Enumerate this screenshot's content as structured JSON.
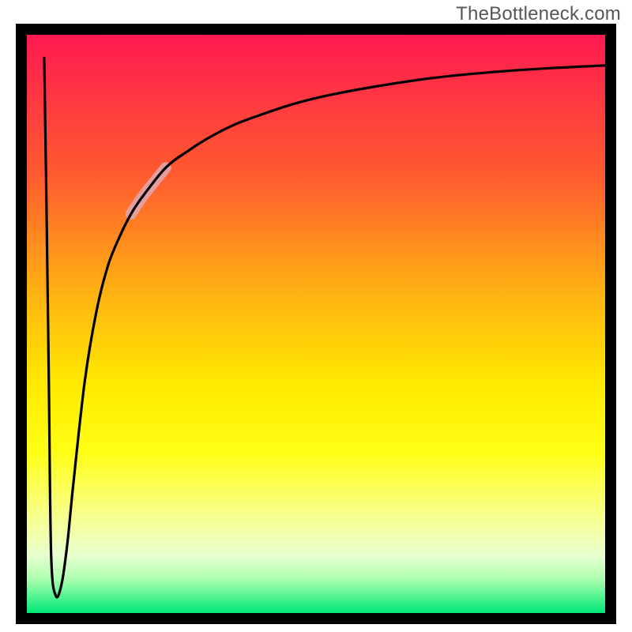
{
  "watermark_text": "TheBottleneck.com",
  "chart_data": {
    "type": "line",
    "title": "",
    "xlabel": "",
    "ylabel": "",
    "xlim": [
      0,
      100
    ],
    "ylim": [
      0,
      100
    ],
    "grid": false,
    "legend": "none",
    "background_gradient": {
      "stops": [
        {
          "offset": 0.0,
          "color": "#ff1a51"
        },
        {
          "offset": 0.25,
          "color": "#ff5d2e"
        },
        {
          "offset": 0.45,
          "color": "#ffb412"
        },
        {
          "offset": 0.6,
          "color": "#ffe800"
        },
        {
          "offset": 0.72,
          "color": "#ffff14"
        },
        {
          "offset": 0.84,
          "color": "#f6ff96"
        },
        {
          "offset": 0.9,
          "color": "#e8ffd0"
        },
        {
          "offset": 0.94,
          "color": "#b0ffb0"
        },
        {
          "offset": 1.0,
          "color": "#00e876"
        }
      ]
    },
    "series": [
      {
        "name": "curve",
        "x": [
          3.0,
          3.4,
          3.8,
          4.2,
          5.0,
          6.0,
          7.0,
          8.0,
          10.0,
          12.0,
          14.0,
          16.0,
          18.0,
          20.0,
          24.0,
          28.0,
          32.0,
          36.0,
          40.0,
          46.0,
          52.0,
          60.0,
          70.0,
          80.0,
          90.0,
          100.0
        ],
        "y": [
          96,
          70,
          40,
          10,
          3,
          5,
          12,
          22,
          40,
          52,
          60,
          65,
          69,
          72,
          77,
          80,
          82.5,
          84.5,
          86,
          88,
          89.5,
          91,
          92.5,
          93.5,
          94.2,
          94.7
        ]
      }
    ],
    "highlight": {
      "description": "light-pink thick segment on rising limb",
      "color": "#e6a0a6",
      "x_range": [
        18,
        24
      ],
      "y_range": [
        69,
        77
      ]
    },
    "annotations": []
  }
}
